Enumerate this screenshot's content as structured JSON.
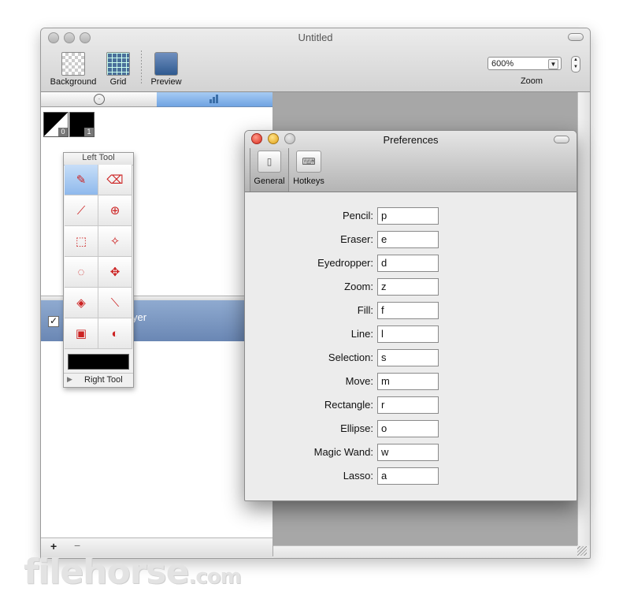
{
  "main_window": {
    "title": "Untitled",
    "toolbar": {
      "background_label": "Background",
      "grid_label": "Grid",
      "preview_label": "Preview",
      "zoom_value": "600%",
      "zoom_label": "Zoom"
    }
  },
  "swatches": [
    {
      "badge": "0"
    },
    {
      "badge": "1"
    }
  ],
  "tool_palette": {
    "title": "Left Tool",
    "footer_label": "Right Tool",
    "selected_color": "#000000",
    "tools": [
      {
        "icon": "pencil-icon",
        "glyph": "✎"
      },
      {
        "icon": "eraser-icon",
        "glyph": "⌫"
      },
      {
        "icon": "eyedropper-icon",
        "glyph": "⟋"
      },
      {
        "icon": "zoom-icon",
        "glyph": "⊕"
      },
      {
        "icon": "selection-icon",
        "glyph": "⬚"
      },
      {
        "icon": "magic-wand-icon",
        "glyph": "✧"
      },
      {
        "icon": "lasso-icon",
        "glyph": "◌"
      },
      {
        "icon": "move-icon",
        "glyph": "✥"
      },
      {
        "icon": "fill-icon",
        "glyph": "◈"
      },
      {
        "icon": "line-icon",
        "glyph": "⟍"
      },
      {
        "icon": "rectangle-icon",
        "glyph": "▣"
      },
      {
        "icon": "ellipse-icon",
        "glyph": "◐"
      }
    ]
  },
  "layers": {
    "partial_name": "yer",
    "add_label": "+",
    "remove_label": "−"
  },
  "preferences": {
    "title": "Preferences",
    "tabs": [
      {
        "label": "General",
        "active": true
      },
      {
        "label": "Hotkeys",
        "active": false
      }
    ],
    "hotkeys": [
      {
        "label": "Pencil:",
        "value": "p"
      },
      {
        "label": "Eraser:",
        "value": "e"
      },
      {
        "label": "Eyedropper:",
        "value": "d"
      },
      {
        "label": "Zoom:",
        "value": "z"
      },
      {
        "label": "Fill:",
        "value": "f"
      },
      {
        "label": "Line:",
        "value": "l"
      },
      {
        "label": "Selection:",
        "value": "s"
      },
      {
        "label": "Move:",
        "value": "m"
      },
      {
        "label": "Rectangle:",
        "value": "r"
      },
      {
        "label": "Ellipse:",
        "value": "o"
      },
      {
        "label": "Magic Wand:",
        "value": "w"
      },
      {
        "label": "Lasso:",
        "value": "a"
      }
    ]
  },
  "watermark": {
    "brand": "filehorse",
    "suffix": ".com"
  }
}
